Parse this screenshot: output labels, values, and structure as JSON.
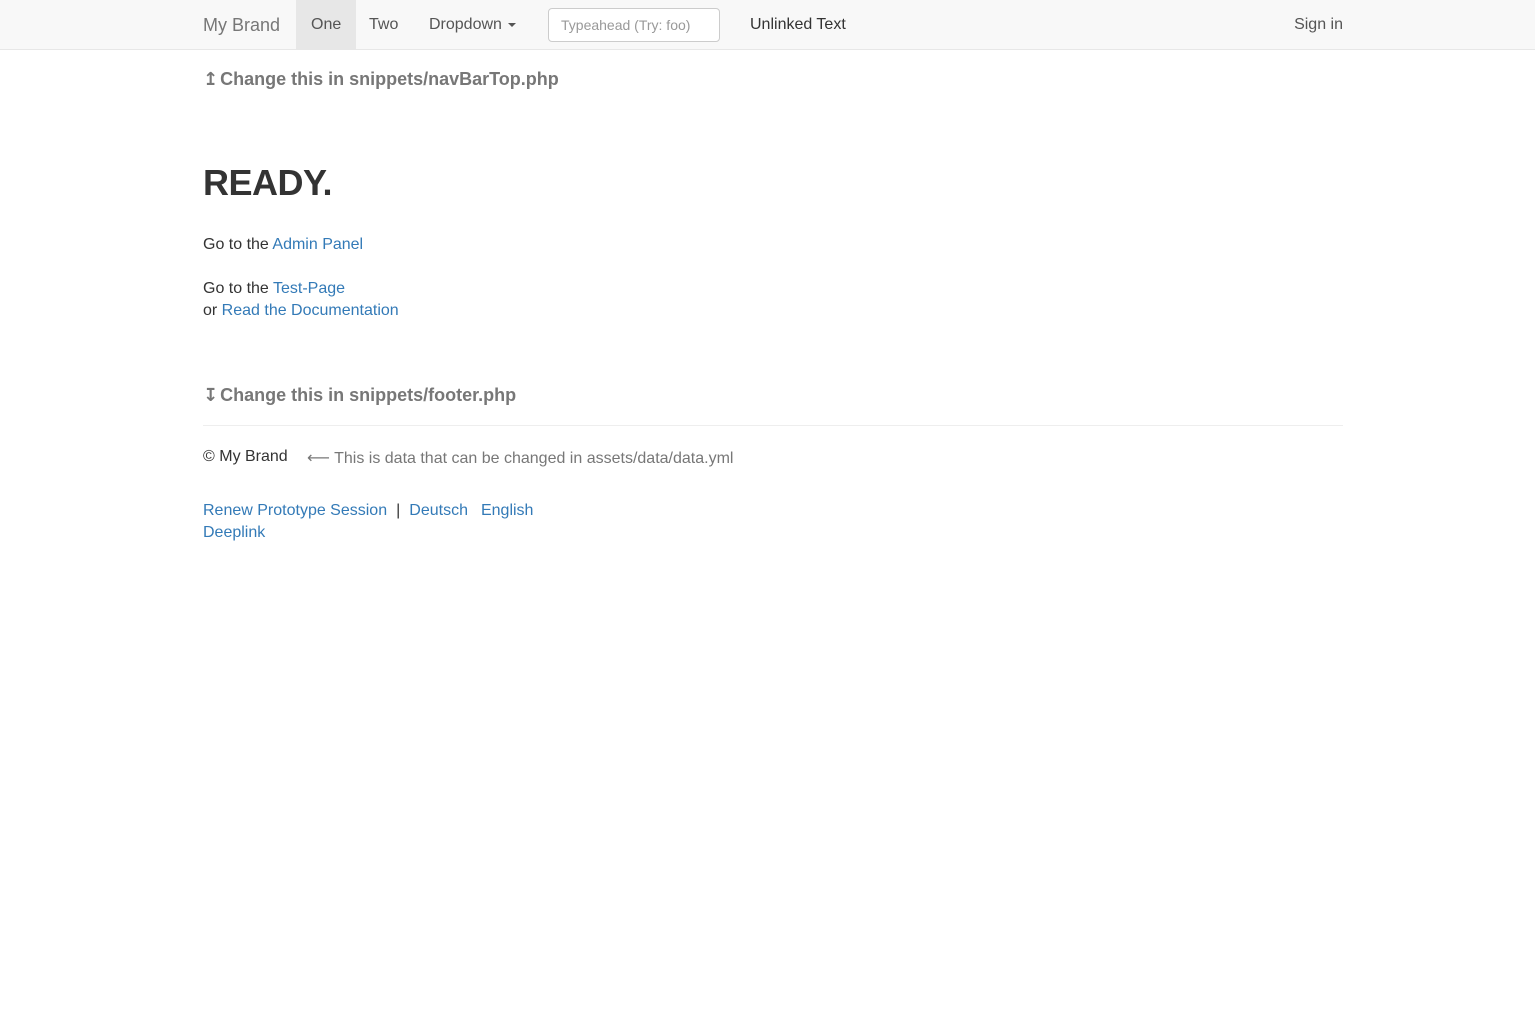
{
  "navbar": {
    "brand": "My Brand",
    "items": [
      {
        "label": "One",
        "active": true
      },
      {
        "label": "Two",
        "active": false
      },
      {
        "label": "Dropdown",
        "active": false
      }
    ],
    "search": {
      "placeholder": "Typeahead (Try: foo)",
      "value": ""
    },
    "unlinked_text": "Unlinked Text",
    "sign_in": "Sign in"
  },
  "hints": {
    "top": {
      "arrow": "↥",
      "text": "Change this in snippets/navBarTop.php"
    },
    "footer": {
      "arrow": "↧",
      "text": "Change this in snippets/footer.php"
    }
  },
  "main": {
    "title": "READY.",
    "lines": [
      {
        "prefix": "Go to the ",
        "link": "Admin Panel"
      },
      {
        "prefix": "Go to the ",
        "link": "Test-Page"
      },
      {
        "prefix": "or ",
        "link": "Read the Documentation"
      }
    ]
  },
  "footer": {
    "copyright": "© My Brand",
    "data_note_arrow": "⟵",
    "data_note": "This is data that can be changed in assets/data/data.yml",
    "renew": "Renew Prototype Session",
    "separator": "|",
    "lang_de": "Deutsch",
    "lang_en": "English",
    "deeplink": "Deeplink"
  }
}
